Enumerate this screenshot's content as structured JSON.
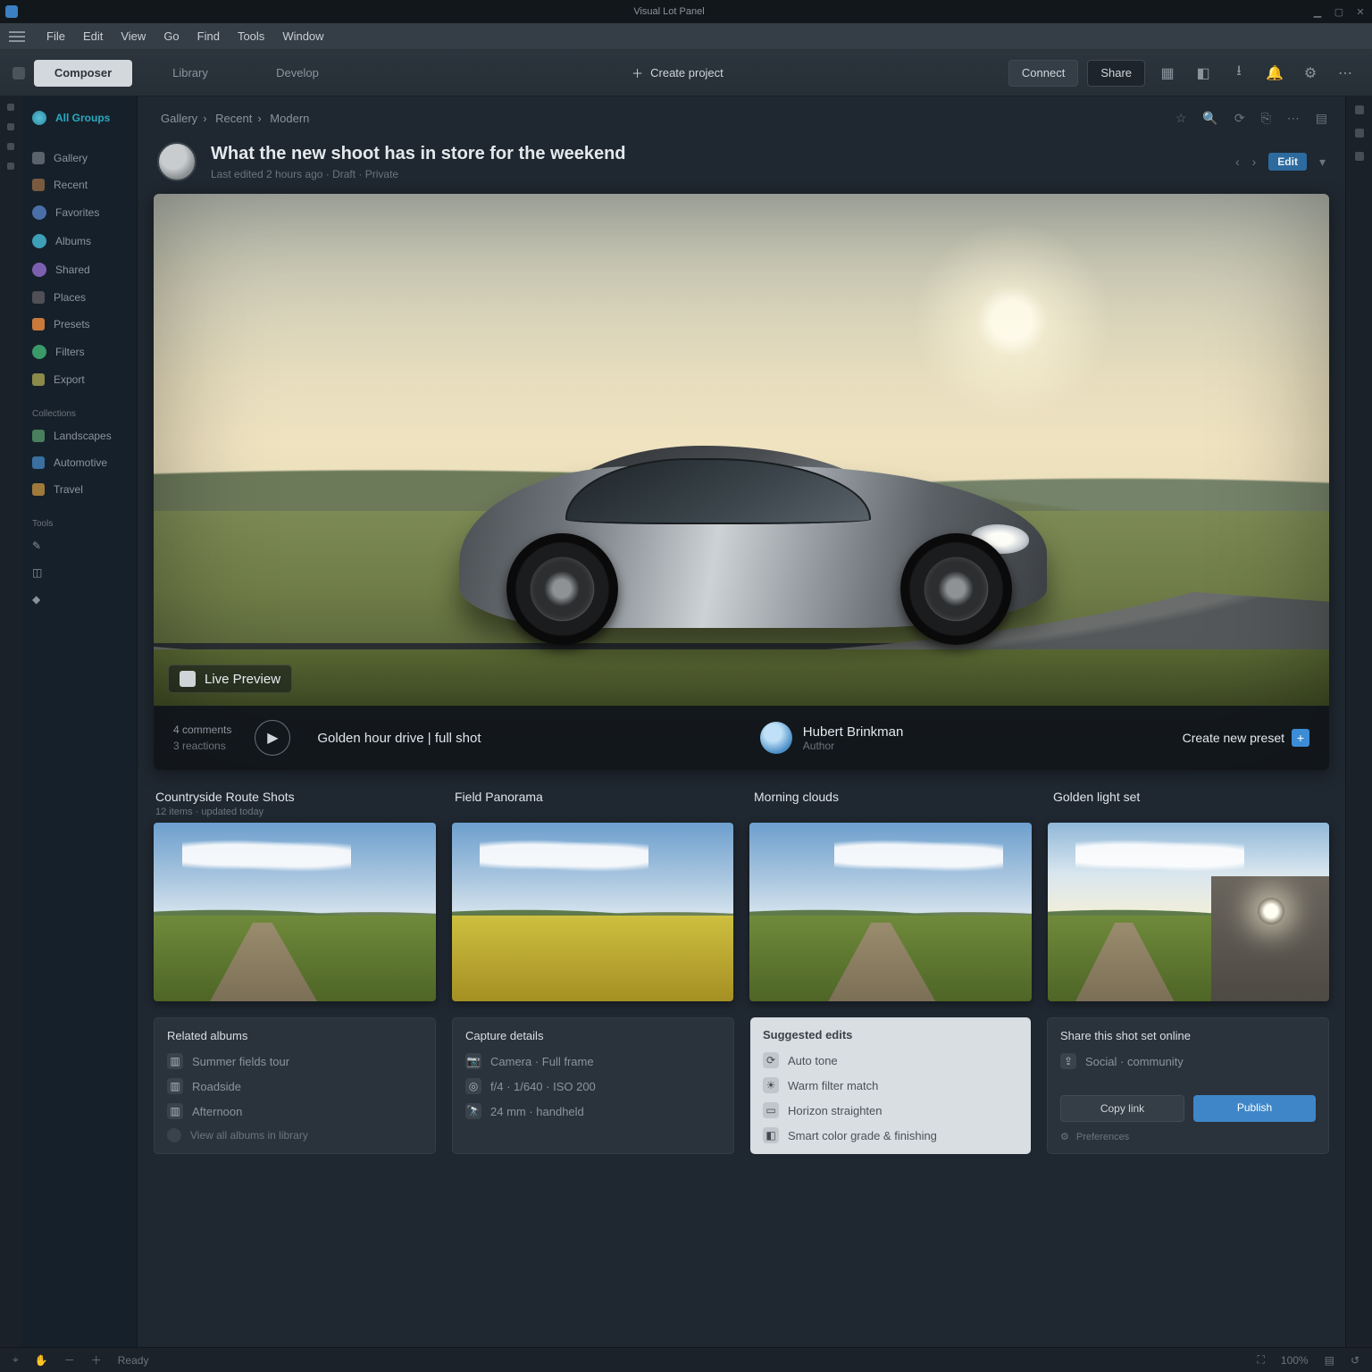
{
  "titlebar": {
    "title": "Visual Lot Panel"
  },
  "menubar": {
    "items": [
      "File",
      "Edit",
      "View",
      "Go",
      "Find",
      "Tools",
      "Window"
    ]
  },
  "toolbar": {
    "tabs": [
      {
        "label": "Composer",
        "active": true
      },
      {
        "label": "Library",
        "active": false
      },
      {
        "label": "Develop",
        "active": false
      }
    ],
    "mid_action_label": "Create project",
    "buttons": {
      "connect": "Connect",
      "share": "Share"
    }
  },
  "sidebar": {
    "primary": "All Groups",
    "items": [
      {
        "label": "Gallery",
        "color": "#5a636c"
      },
      {
        "label": "Recent",
        "color": "#7a5a3f"
      },
      {
        "label": "Favorites",
        "color": "#4a6fa8"
      },
      {
        "label": "Albums",
        "color": "#3e9fb8"
      },
      {
        "label": "Shared",
        "color": "#7d5fb0"
      },
      {
        "label": "Places",
        "color": "#4f4f55"
      },
      {
        "label": "Presets",
        "color": "#c97a3a"
      },
      {
        "label": "Filters",
        "color": "#3a9a6a"
      },
      {
        "label": "Export",
        "color": "#8a8a4a"
      }
    ],
    "section2_label": "Collections",
    "section2": [
      {
        "label": "Landscapes",
        "color": "#4a7f5e"
      },
      {
        "label": "Automotive",
        "color": "#3a6fa0"
      },
      {
        "label": "Travel",
        "color": "#a07a3a"
      }
    ],
    "tools_label": "Tools"
  },
  "breadcrumb": {
    "a": "Gallery",
    "b": "Recent",
    "c": "Modern"
  },
  "article": {
    "title": "What the new shoot has in store for the weekend",
    "subtitle": "Last edited 2 hours ago · Draft · Private",
    "badge": "Edit"
  },
  "hero": {
    "chip": "Live Preview",
    "meta_small_a": "4 comments",
    "meta_small_b": "3 reactions",
    "caption": "Golden hour drive | full shot",
    "author_name": "Hubert Brinkman",
    "author_role": "Author",
    "cta": "Create new preset"
  },
  "row_headers": [
    {
      "title": "Countryside Route Shots",
      "sub": "12 items · updated today"
    },
    {
      "title": "Field Panorama",
      "sub": ""
    },
    {
      "title": "Morning clouds",
      "sub": ""
    },
    {
      "title": "Golden light set",
      "sub": ""
    }
  ],
  "meta_cards": {
    "c1": {
      "title": "Related albums",
      "items": [
        "Summer fields tour",
        "Roadside",
        "Afternoon"
      ],
      "foot": "View all albums in library"
    },
    "c2": {
      "title": "Capture details",
      "items": [
        "Camera · Full frame",
        "f/4 · 1/640 · ISO 200",
        "24 mm · handheld"
      ]
    },
    "c3": {
      "title": "Suggested edits",
      "items": [
        "Auto tone",
        "Warm filter match",
        "Horizon straighten",
        "Smart color grade & finishing"
      ]
    },
    "c4": {
      "title": "Share this shot set online",
      "sub": "Social · community",
      "action_a": "Copy link",
      "action_b": "Publish",
      "tiny": "Preferences"
    }
  },
  "statusbar": {
    "label": "Ready",
    "zoom": "100%"
  }
}
